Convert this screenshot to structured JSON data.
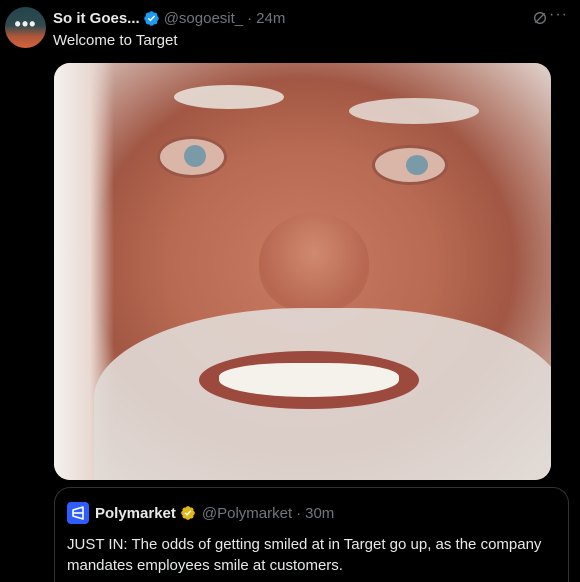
{
  "tweet": {
    "display_name": "So it Goes...",
    "handle": "@sogoesit_",
    "separator": "·",
    "time": "24m",
    "text": "Welcome to Target",
    "avatar_glyph": "•••",
    "more_glyph": "···",
    "icons": [
      "verified-badge-icon",
      "grok-icon",
      "more-icon"
    ]
  },
  "quoted": {
    "display_name": "Polymarket",
    "handle": "@Polymarket",
    "separator": "·",
    "time": "30m",
    "text": "JUST IN: The odds of getting smiled at in Target go up, as the company mandates employees smile at customers.",
    "icons": [
      "polymarket-logo-icon",
      "gold-verified-badge-icon"
    ]
  },
  "colors": {
    "background": "#000000",
    "text": "#e7e9ea",
    "muted": "#71767b",
    "verified_blue": "#1d9bf0",
    "verified_gold": "#e2b719",
    "polymarket_blue": "#2e5cff",
    "border": "#2f3336"
  }
}
